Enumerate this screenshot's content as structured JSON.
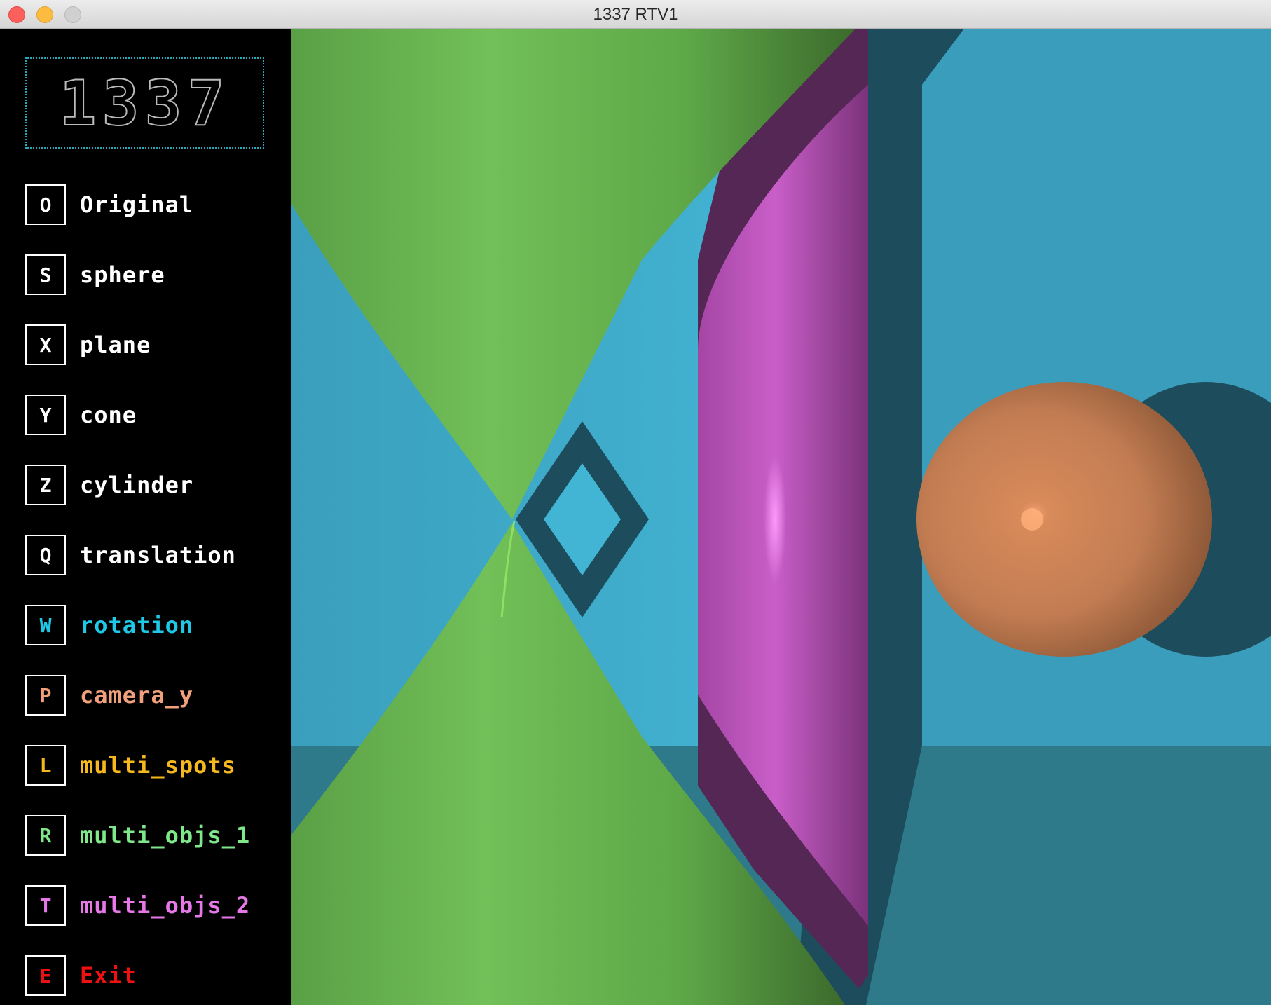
{
  "window": {
    "title": "1337 RTV1"
  },
  "logo": {
    "text": "1337"
  },
  "menu": {
    "items": [
      {
        "key": "O",
        "label": "Original",
        "color": "#ffffff"
      },
      {
        "key": "S",
        "label": "sphere",
        "color": "#ffffff"
      },
      {
        "key": "X",
        "label": "plane",
        "color": "#ffffff"
      },
      {
        "key": "Y",
        "label": "cone",
        "color": "#ffffff"
      },
      {
        "key": "Z",
        "label": "cylinder",
        "color": "#ffffff"
      },
      {
        "key": "Q",
        "label": "translation",
        "color": "#ffffff"
      },
      {
        "key": "W",
        "label": "rotation",
        "color": "#1ec8e6"
      },
      {
        "key": "P",
        "label": "camera_y",
        "color": "#f0a07a"
      },
      {
        "key": "L",
        "label": "multi_spots",
        "color": "#f5b81e"
      },
      {
        "key": "R",
        "label": "multi_objs_1",
        "color": "#7ee88a"
      },
      {
        "key": "T",
        "label": "multi_objs_2",
        "color": "#e878e8"
      },
      {
        "key": "E",
        "label": "Exit",
        "color": "#ee1111"
      }
    ]
  },
  "scene": {
    "background_color": "#3aa2c0",
    "cone_color": "#6aba52",
    "cylinder_color": "#b852b8",
    "sphere_color": "#c58054",
    "floor_color": "#2e7a8a"
  }
}
